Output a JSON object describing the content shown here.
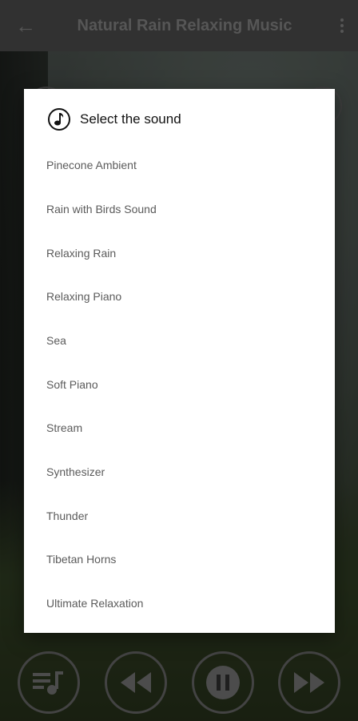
{
  "app_bar": {
    "title": "Natural Rain Relaxing Music",
    "back_icon": "arrow-left-icon",
    "more_icon": "more-vert-icon"
  },
  "dialog": {
    "title": "Select the sound",
    "icon": "music-note-icon",
    "items": [
      "Pinecone Ambient",
      "Rain with Birds Sound",
      "Relaxing Rain",
      "Relaxing Piano",
      "Sea",
      "Soft Piano",
      "Stream",
      "Synthesizer",
      "Thunder",
      "Tibetan Horns",
      "Ultimate Relaxation"
    ]
  },
  "controls": {
    "playlist_icon": "playlist-music-icon",
    "rewind_icon": "rewind-icon",
    "pause_icon": "pause-icon",
    "fast_forward_icon": "fast-forward-icon"
  }
}
